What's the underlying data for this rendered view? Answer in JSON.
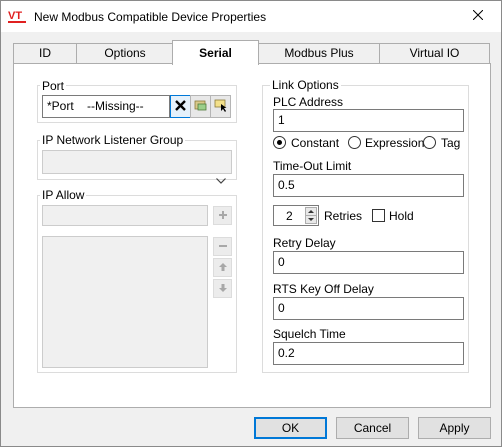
{
  "window": {
    "logo_text": "VT",
    "title": "New Modbus Compatible Device Properties"
  },
  "tabs": [
    {
      "label": "ID"
    },
    {
      "label": "Options"
    },
    {
      "label": "Serial",
      "active": true
    },
    {
      "label": "Modbus Plus"
    },
    {
      "label": "Virtual IO"
    }
  ],
  "port": {
    "group_label": "Port",
    "value": "*Port    --Missing--",
    "icons": [
      "clear-icon",
      "browse-folder-icon",
      "select-tag-icon"
    ]
  },
  "ip_network": {
    "group_label": "IP Network Listener Group",
    "selected": ""
  },
  "ip_allow": {
    "group_label": "IP Allow",
    "input_value": "",
    "buttons": [
      "add-icon",
      "remove-icon",
      "move-up-icon",
      "move-down-icon"
    ],
    "items": []
  },
  "link_options": {
    "group_label": "Link Options",
    "plc_address_label": "PLC Address",
    "plc_address_value": "1",
    "mode_options": [
      {
        "label": "Constant",
        "checked": true
      },
      {
        "label": "Expression",
        "checked": false
      },
      {
        "label": "Tag",
        "checked": false
      }
    ],
    "timeout_label": "Time-Out Limit",
    "timeout_value": "0.5",
    "retries_value": "2",
    "retries_label": "Retries",
    "hold_label": "Hold",
    "hold_checked": false,
    "retry_delay_label": "Retry Delay",
    "retry_delay_value": "0",
    "rts_label": "RTS Key Off Delay",
    "rts_value": "0",
    "squelch_label": "Squelch Time",
    "squelch_value": "0.2"
  },
  "footer": {
    "ok_label": "OK",
    "cancel_label": "Cancel",
    "apply_label": "Apply"
  },
  "colors": {
    "logo_red": "#e02020",
    "accent_blue": "#0078d7"
  }
}
